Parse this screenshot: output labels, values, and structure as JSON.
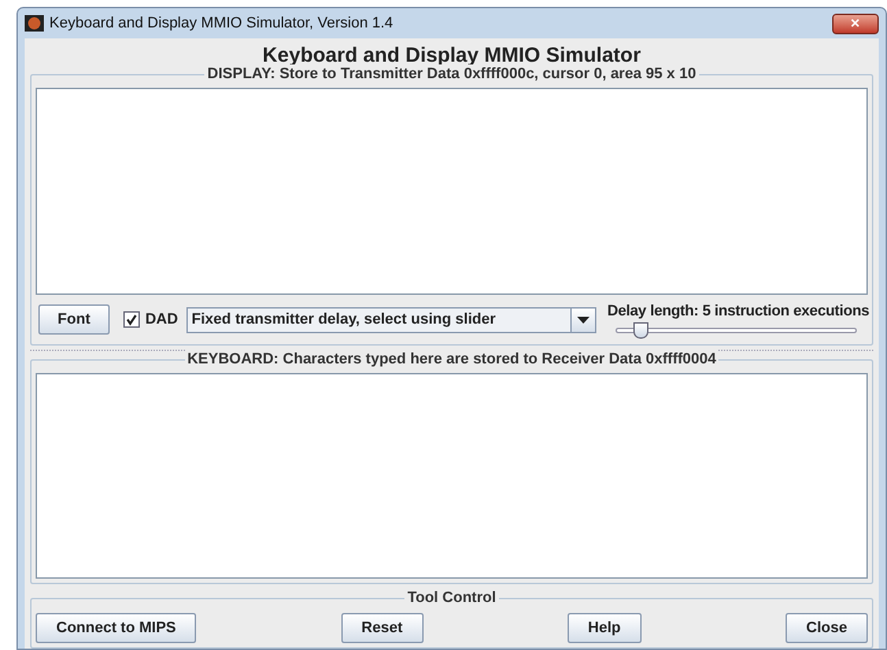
{
  "window": {
    "title": "Keyboard and Display MMIO Simulator, Version 1.4",
    "close_glyph": "✕"
  },
  "heading": "Keyboard and Display MMIO Simulator",
  "display": {
    "title": "DISPLAY: Store to Transmitter Data 0xffff000c, cursor 0, area 95 x 10"
  },
  "controls": {
    "font_button": "Font",
    "dad": {
      "label": "DAD",
      "checked": true
    },
    "delay_mode": "Fixed transmitter delay, select using slider",
    "delay": {
      "label": "Delay length: 5 instruction executions",
      "level": 0.1
    }
  },
  "keyboard": {
    "title": "KEYBOARD: Characters typed here are stored to Receiver Data 0xffff0004"
  },
  "tool_control": {
    "title": "Tool Control",
    "buttons": [
      "Connect to MIPS",
      "Reset",
      "Help",
      "Close"
    ]
  }
}
